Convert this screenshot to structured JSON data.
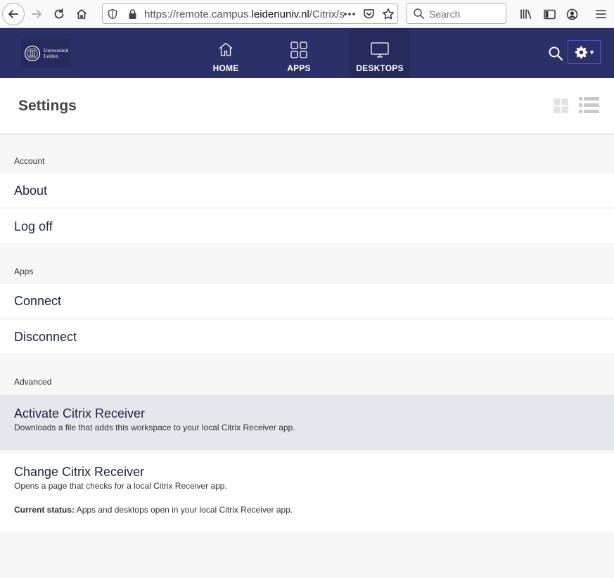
{
  "browser": {
    "url_prefix": "https://remote.campus.",
    "url_host": "leidenuniv.nl",
    "url_suffix": "/Citrix/s",
    "search_placeholder": "Search"
  },
  "header": {
    "logo_line1": "Universiteit",
    "logo_line2": "Leiden",
    "nav": [
      {
        "label": "HOME"
      },
      {
        "label": "APPS"
      },
      {
        "label": "DESKTOPS"
      }
    ],
    "settings_caret": "▾"
  },
  "page": {
    "title": "Settings"
  },
  "sections": {
    "account": {
      "label": "Account",
      "items": [
        {
          "title": "About"
        },
        {
          "title": "Log off"
        }
      ]
    },
    "apps": {
      "label": "Apps",
      "items": [
        {
          "title": "Connect"
        },
        {
          "title": "Disconnect"
        }
      ]
    },
    "advanced": {
      "label": "Advanced",
      "items": [
        {
          "title": "Activate Citrix Receiver",
          "desc": "Downloads a file that adds this workspace to your local Citrix Receiver app."
        },
        {
          "title": "Change Citrix Receiver",
          "desc": "Opens a page that checks for a local Citrix Receiver app.",
          "status_label": "Current status:",
          "status_value": " Apps and desktops open in your local Citrix Receiver app."
        }
      ]
    }
  },
  "colors": {
    "header_bg": "#2c3068",
    "highlight_row": "#e6e7ec"
  }
}
